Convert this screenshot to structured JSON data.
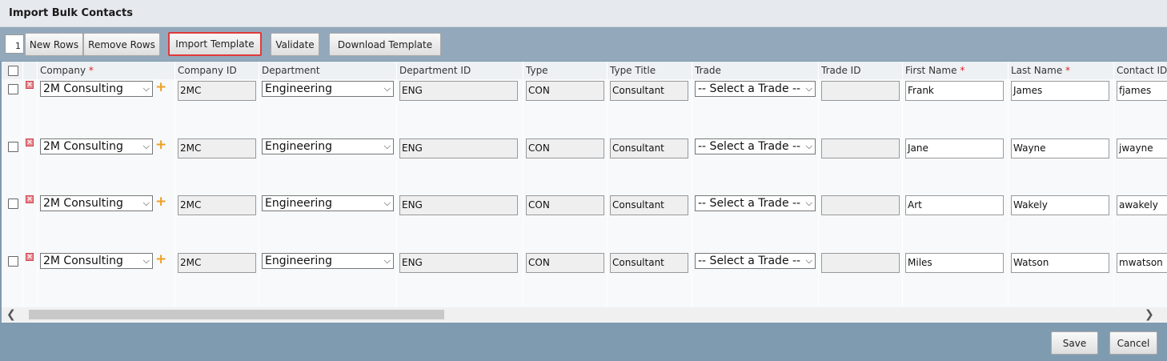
{
  "window": {
    "title": "Import Bulk Contacts"
  },
  "toolbar": {
    "row_count": "1",
    "new_rows": "New Rows",
    "remove_rows": "Remove Rows",
    "import_template": "Import Template",
    "validate": "Validate",
    "download_template": "Download Template"
  },
  "grid": {
    "headers": {
      "company": "Company",
      "company_id": "Company ID",
      "department": "Department",
      "department_id": "Department ID",
      "type": "Type",
      "type_title": "Type Title",
      "trade": "Trade",
      "trade_id": "Trade ID",
      "first_name": "First Name",
      "last_name": "Last Name",
      "contact_id": "Contact ID"
    },
    "required_marker": "*",
    "rows": [
      {
        "company": "2M Consulting",
        "company_id": "2MC",
        "department": "Engineering",
        "department_id": "ENG",
        "type": "CON",
        "type_title": "Consultant",
        "trade": "-- Select a Trade --",
        "trade_id": "",
        "first_name": "Frank",
        "last_name": "James",
        "contact_id": "fjames"
      },
      {
        "company": "2M Consulting",
        "company_id": "2MC",
        "department": "Engineering",
        "department_id": "ENG",
        "type": "CON",
        "type_title": "Consultant",
        "trade": "-- Select a Trade --",
        "trade_id": "",
        "first_name": "Jane",
        "last_name": "Wayne",
        "contact_id": "jwayne"
      },
      {
        "company": "2M Consulting",
        "company_id": "2MC",
        "department": "Engineering",
        "department_id": "ENG",
        "type": "CON",
        "type_title": "Consultant",
        "trade": "-- Select a Trade --",
        "trade_id": "",
        "first_name": "Art",
        "last_name": "Wakely",
        "contact_id": "awakely"
      },
      {
        "company": "2M Consulting",
        "company_id": "2MC",
        "department": "Engineering",
        "department_id": "ENG",
        "type": "CON",
        "type_title": "Consultant",
        "trade": "-- Select a Trade --",
        "trade_id": "",
        "first_name": "Miles",
        "last_name": "Watson",
        "contact_id": "mwatson"
      }
    ]
  },
  "footer": {
    "save": "Save",
    "cancel": "Cancel"
  },
  "icons": {
    "delete_row": "delete-x-icon",
    "add_company": "plus-icon",
    "dropdown": "chevron-down-icon",
    "scroll_left": "chevron-left-icon",
    "scroll_right": "chevron-right-icon"
  },
  "colors": {
    "highlight": "#e03a3a",
    "required": "#e02020",
    "add_icon": "#f0a020"
  }
}
